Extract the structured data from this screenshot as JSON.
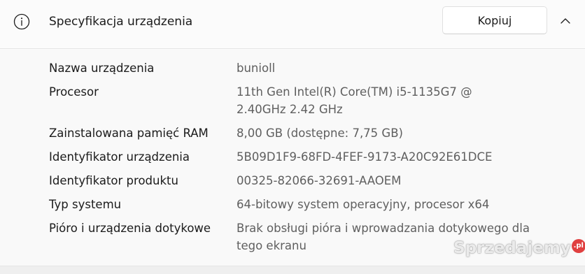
{
  "header": {
    "title": "Specyfikacja urządzenia",
    "copy_label": "Kopiuj",
    "info_icon": "info-icon",
    "collapse_icon": "chevron-up-icon"
  },
  "specs": [
    {
      "label": "Nazwa urządzenia",
      "value": "bunioll"
    },
    {
      "label": "Procesor",
      "value": "11th Gen Intel(R) Core(TM) i5-1135G7 @ 2.40GHz 2.42 GHz"
    },
    {
      "label": "Zainstalowana pamięć RAM",
      "value": "8,00 GB (dostępne: 7,75 GB)"
    },
    {
      "label": "Identyfikator urządzenia",
      "value": "5B09D1F9-68FD-4FEF-9173-A20C92E61DCE"
    },
    {
      "label": "Identyfikator produktu",
      "value": "00325-82066-32691-AAOEM"
    },
    {
      "label": "Typ systemu",
      "value": "64-bitowy system operacyjny, procesor x64"
    },
    {
      "label": "Pióro i urządzenia dotykowe",
      "value": "Brak obsługi pióra i wprowadzania dotykowego dla tego ekranu"
    }
  ],
  "watermark": {
    "text": "Sprzedajemy",
    "suffix": ".pl"
  }
}
